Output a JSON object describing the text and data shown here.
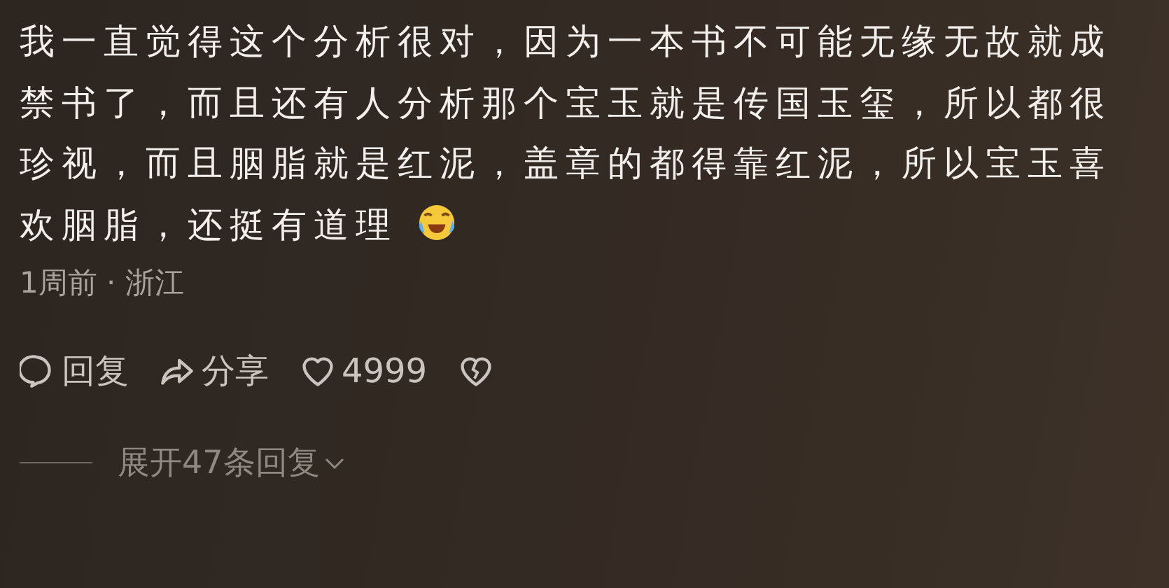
{
  "comment": {
    "text": "我一直觉得这个分析很对，因为一本书不可能无缘无故就成禁书了，而且还有人分析那个宝玉就是传国玉玺，所以都很珍视，而且胭脂就是红泥，盖章的都得靠红泥，所以宝玉喜欢胭脂，还挺有道理",
    "emoji": true,
    "meta": "1周前 · 浙江",
    "actions": [
      {
        "kind": "reply",
        "label": "回复"
      },
      {
        "kind": "share",
        "label": "分享"
      },
      {
        "kind": "like",
        "label": "4999",
        "selected": false
      },
      {
        "kind": "dislike",
        "selected": false
      }
    ],
    "expand": "展开47条回复"
  }
}
